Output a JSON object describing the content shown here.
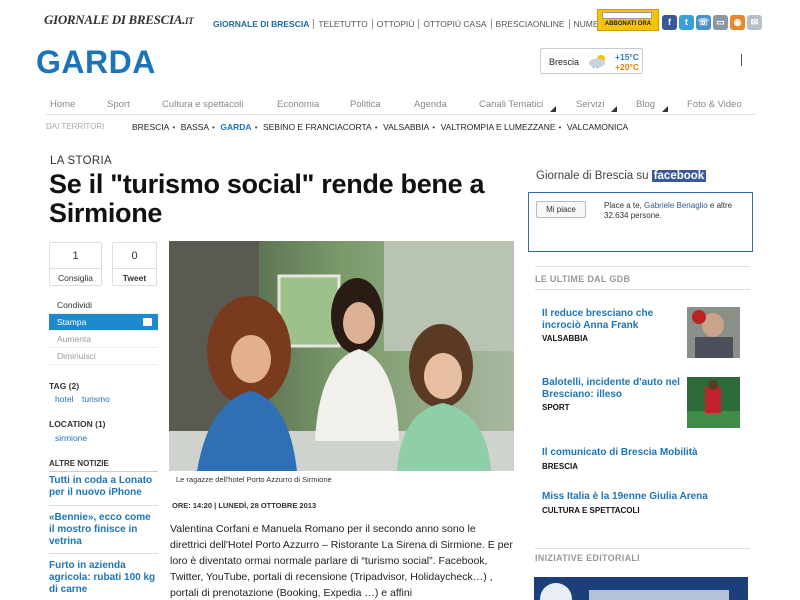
{
  "site": {
    "logo_text": "GIORNALE DI BRESCIA.it",
    "top_nav": [
      "GIORNALE DI BRESCIA",
      "TELETUTTO",
      "OTTOPIÙ",
      "OTTOPIÙ CASA",
      "BRESCIAONLINE",
      "NUMERICA"
    ],
    "abbonati_label": "ABBONATI ORA",
    "social_icons": [
      "facebook-icon",
      "twitter-icon",
      "phone-icon",
      "tablet-icon",
      "mobile-icon",
      "rss-icon",
      "mail-icon"
    ]
  },
  "header": {
    "section_title": "GARDA",
    "weather": {
      "city": "Brescia",
      "temp_min": "+15°C",
      "temp_max": "+20°C"
    }
  },
  "main_nav": [
    "Home",
    "Sport",
    "Cultura e spettacoli",
    "Economia",
    "Politica",
    "Agenda",
    "Canali Tematici",
    "Servizi",
    "Blog",
    "Foto & Video"
  ],
  "sub_nav": {
    "label": "DAI TERRITORI",
    "items": [
      "BRESCIA",
      "BASSA",
      "GARDA",
      "SEBINO E FRANCIACORTA",
      "VALSABBIA",
      "VALTROMPIA E LUMEZZANE",
      "VALCAMONICA"
    ],
    "active": "GARDA"
  },
  "article": {
    "kicker": "LA STORIA",
    "headline": "Se il \"turismo social\" rende bene a Sirmione",
    "share": {
      "like_count": "1",
      "like_label": "Consiglia",
      "tweet_count": "0",
      "tweet_label": "Tweet"
    },
    "tools": {
      "share": "Condividi",
      "print": "Stampa",
      "increase": "Aumenta",
      "decrease": "Diminuisci"
    },
    "tags": {
      "heading": "TAG (2)",
      "items": [
        "hotel",
        "turismo"
      ]
    },
    "location": {
      "heading": "LOCATION (1)",
      "items": [
        "sirmione"
      ]
    },
    "caption": "Le ragazze dell'hotel Porto Azzurro di Sirmione",
    "time": "ORE: 14:20",
    "date": "LUNEDÌ, 28 OTTOBRE 2013",
    "body": "Valentina Corfani e Manuela Romano per il secondo anno sono le direttrici dell'Hotel Porto Azzurro – Ristorante La Sirena di Sirmione. E per loro è diventato ormai normale parlare di “turismo social”. Facebook, Twitter, YouTube, portali di recensione (Tripadvisor, Holidaycheck…) , portali di prenotazione (Booking, Expedia …) e affini"
  },
  "altre_notizie": {
    "heading": "ALTRE NOTIZIE",
    "items": [
      "Tutti in coda a Lonato per il nuovo iPhone",
      "«Bennie», ecco come il mostro finisce in vetrina",
      "Furto in azienda agricola: rubati 100 kg di carne"
    ]
  },
  "facebook_box": {
    "title_prefix": "Giornale di Brescia su",
    "brand": "facebook",
    "button_label": "Mi piace",
    "text_prefix": "Place a te,",
    "user_name": "Gabriele Benaglio",
    "text_suffix": "e altre 32.634 persone."
  },
  "ultime": {
    "heading": "LE ULTIME DAL GDB",
    "items": [
      {
        "title": "Il reduce bresciano che incrociò Anna Frank",
        "category": "VALSABBIA"
      },
      {
        "title": "Balotelli, incidente d'auto nel Bresciano: illeso",
        "category": "SPORT"
      },
      {
        "title": "Il comunicato di Brescia Mobilità",
        "category": "BRESCIA"
      },
      {
        "title": "Miss Italia è la 19enne Giulia Arena",
        "category": "CULTURA E SPETTACOLI"
      }
    ]
  },
  "iniziative": {
    "heading": "INIZIATIVE EDITORIALI"
  },
  "colors": {
    "brand_blue": "#1c75b8",
    "print_blue": "#1d8acd",
    "facebook": "#3b5998",
    "abbonati_yellow": "#f3c400"
  }
}
